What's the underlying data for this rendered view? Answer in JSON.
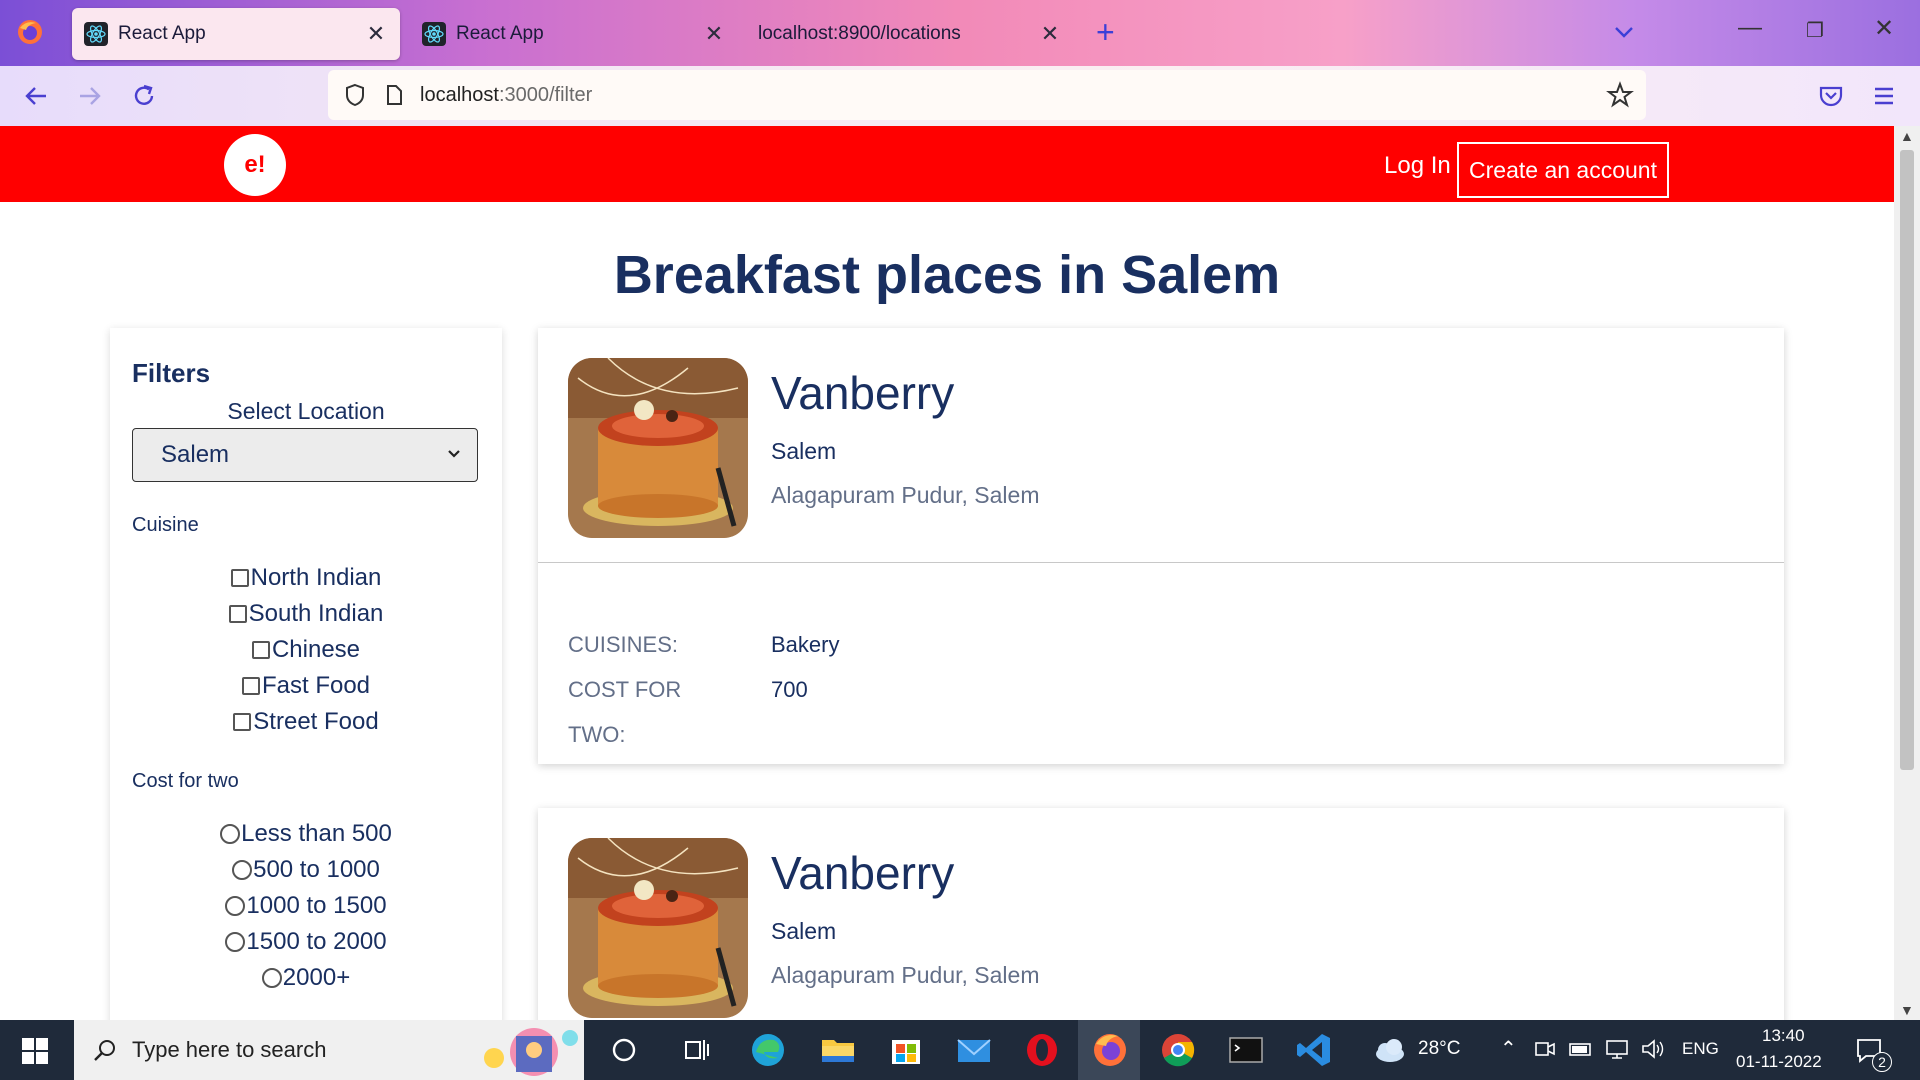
{
  "browser": {
    "tabs": [
      {
        "title": "React App",
        "icon": "react-icon",
        "active": true
      },
      {
        "title": "React App",
        "icon": "react-icon",
        "active": false
      },
      {
        "title": "localhost:8900/locations",
        "icon": "",
        "active": false
      }
    ],
    "url_host": "localhost",
    "url_path": ":3000/filter"
  },
  "header": {
    "brand": "e!",
    "login_label": "Log In",
    "create_label": "Create an account"
  },
  "page": {
    "title": "Breakfast places in Salem"
  },
  "filters": {
    "heading": "Filters",
    "location_label": "Select Location",
    "location_value": "Salem",
    "cuisine_label": "Cuisine",
    "cuisines": [
      "North Indian",
      "South Indian",
      "Chinese",
      "Fast Food",
      "Street Food"
    ],
    "cost_label": "Cost for two",
    "costs": [
      "Less than 500",
      "500 to 1000",
      "1000 to 1500",
      "1500 to 2000",
      "2000+"
    ]
  },
  "restaurants": [
    {
      "name": "Vanberry",
      "city": "Salem",
      "address": "Alagapuram Pudur, Salem",
      "cuisines_label": "CUISINES:",
      "cuisines": "Bakery",
      "cost_label_1": "COST FOR",
      "cost_label_2": "TWO:",
      "cost": "700"
    },
    {
      "name": "Vanberry",
      "city": "Salem",
      "address": "Alagapuram Pudur, Salem"
    }
  ],
  "taskbar": {
    "search_placeholder": "Type here to search",
    "weather": "28°C",
    "language": "ENG",
    "time": "13:40",
    "date": "01-11-2022",
    "notification_count": "2"
  },
  "colors": {
    "header_red": "#ff0000",
    "heading_navy": "#192f60",
    "muted_text": "#636f88"
  }
}
